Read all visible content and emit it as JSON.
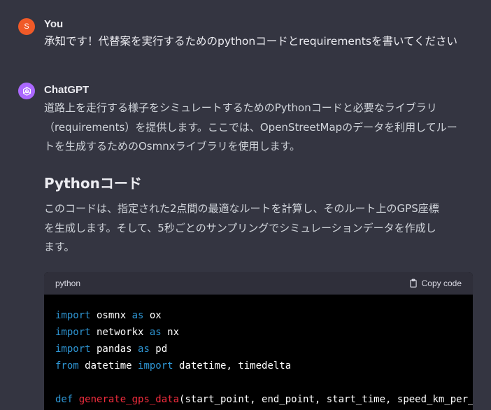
{
  "user_message": {
    "avatar_letter": "S",
    "author": "You",
    "text": "承知です！代替案を実行するためのpythonコードとrequirementsを書いてください"
  },
  "assistant_message": {
    "author": "ChatGPT",
    "avatar_icon": "openai-logo-icon",
    "intro_lines": [
      "道路上を走行する様子をシミュレートするためのPythonコードと必要なライブラリ",
      "（requirements）を提供します。ここでは、OpenStreetMapのデータを利用してルー",
      "トを生成するためのOsmnxライブラリを使用します。"
    ],
    "section_title": "Pythonコード",
    "para_lines": [
      "このコードは、指定された2点間の最適なルートを計算し、そのルート上のGPS座標",
      "を生成します。そして、5秒ごとのサンプリングでシミュレーションデータを作成し",
      "ます。"
    ]
  },
  "code_block": {
    "language": "python",
    "copy_label": "Copy code",
    "lines": [
      {
        "kw1": "import",
        "t1": " osmnx ",
        "kw2": "as",
        "t2": " ox"
      },
      {
        "kw1": "import",
        "t1": " networkx ",
        "kw2": "as",
        "t2": " nx"
      },
      {
        "kw1": "import",
        "t1": " pandas ",
        "kw2": "as",
        "t2": " pd"
      },
      {
        "kw1": "from",
        "t1": " datetime ",
        "kw2": "import",
        "t2": " datetime, timedelta"
      }
    ],
    "def_line": {
      "kw": "def",
      "fn": "generate_gps_data",
      "rest": "(start_point, end_point, start_time, speed_km_per_"
    }
  },
  "colors": {
    "background": "#343541",
    "user_avatar": "#f05a28",
    "gpt_avatar": "#ab68ff",
    "code_keyword": "#2e95d3",
    "code_function": "#f22c3d"
  }
}
